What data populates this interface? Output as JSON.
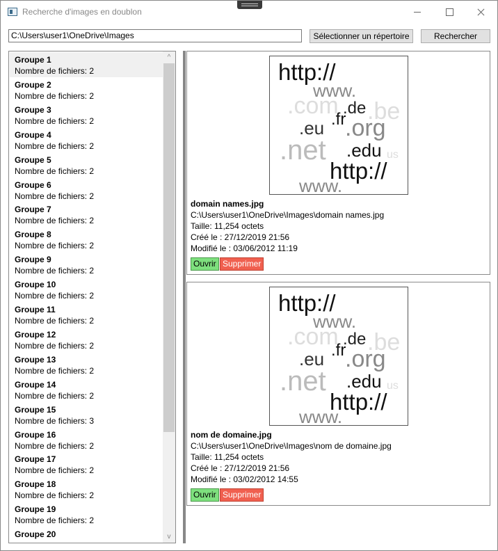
{
  "window": {
    "title": "Recherche d'images en doublon"
  },
  "toolbar": {
    "path_value": "C:\\Users\\user1\\OneDrive\\Images",
    "select_label": "Sélectionner un répertoire",
    "search_label": "Rechercher"
  },
  "groups": [
    {
      "name": "Groupe 1",
      "count": "Nombre de fichiers: 2"
    },
    {
      "name": "Groupe 2",
      "count": "Nombre de fichiers: 2"
    },
    {
      "name": "Groupe 3",
      "count": "Nombre de fichiers: 2"
    },
    {
      "name": "Groupe 4",
      "count": "Nombre de fichiers: 2"
    },
    {
      "name": "Groupe 5",
      "count": "Nombre de fichiers: 2"
    },
    {
      "name": "Groupe 6",
      "count": "Nombre de fichiers: 2"
    },
    {
      "name": "Groupe 7",
      "count": "Nombre de fichiers: 2"
    },
    {
      "name": "Groupe 8",
      "count": "Nombre de fichiers: 2"
    },
    {
      "name": "Groupe 9",
      "count": "Nombre de fichiers: 2"
    },
    {
      "name": "Groupe 10",
      "count": "Nombre de fichiers: 2"
    },
    {
      "name": "Groupe 11",
      "count": "Nombre de fichiers: 2"
    },
    {
      "name": "Groupe 12",
      "count": "Nombre de fichiers: 2"
    },
    {
      "name": "Groupe 13",
      "count": "Nombre de fichiers: 2"
    },
    {
      "name": "Groupe 14",
      "count": "Nombre de fichiers: 2"
    },
    {
      "name": "Groupe 15",
      "count": "Nombre de fichiers: 3"
    },
    {
      "name": "Groupe 16",
      "count": "Nombre de fichiers: 2"
    },
    {
      "name": "Groupe 17",
      "count": "Nombre de fichiers: 2"
    },
    {
      "name": "Groupe 18",
      "count": "Nombre de fichiers: 2"
    },
    {
      "name": "Groupe 19",
      "count": "Nombre de fichiers: 2"
    },
    {
      "name": "Groupe 20",
      "count": ""
    }
  ],
  "image_text": {
    "http": "http://",
    "www": "www.",
    "com": ".com",
    "de": ".de",
    "be": ".be",
    "fr": ".fr",
    "eu": ".eu",
    "org": ".org",
    "net": ".net",
    "edu": ".edu",
    "us": "us"
  },
  "files": [
    {
      "name": "domain names.jpg",
      "path": "C:\\Users\\user1\\OneDrive\\Images\\domain names.jpg",
      "size": "Taille: 11,254 octets",
      "created": "Créé le : 27/12/2019 21:56",
      "modified": "Modifié le : 03/06/2012 11:19",
      "open_label": "Ouvrir",
      "delete_label": "Supprimer"
    },
    {
      "name": "nom de domaine.jpg",
      "path": "C:\\Users\\user1\\OneDrive\\Images\\nom de domaine.jpg",
      "size": "Taille: 11,254 octets",
      "created": "Créé le : 27/12/2019 21:56",
      "modified": "Modifié le : 03/02/2012 14:55",
      "open_label": "Ouvrir",
      "delete_label": "Supprimer"
    }
  ],
  "colors": {
    "open": "#7ee07e",
    "delete": "#f06050"
  },
  "icons": [
    "app-icon",
    "minimize-icon",
    "maximize-icon",
    "close-icon",
    "scroll-up-icon",
    "scroll-down-icon"
  ]
}
